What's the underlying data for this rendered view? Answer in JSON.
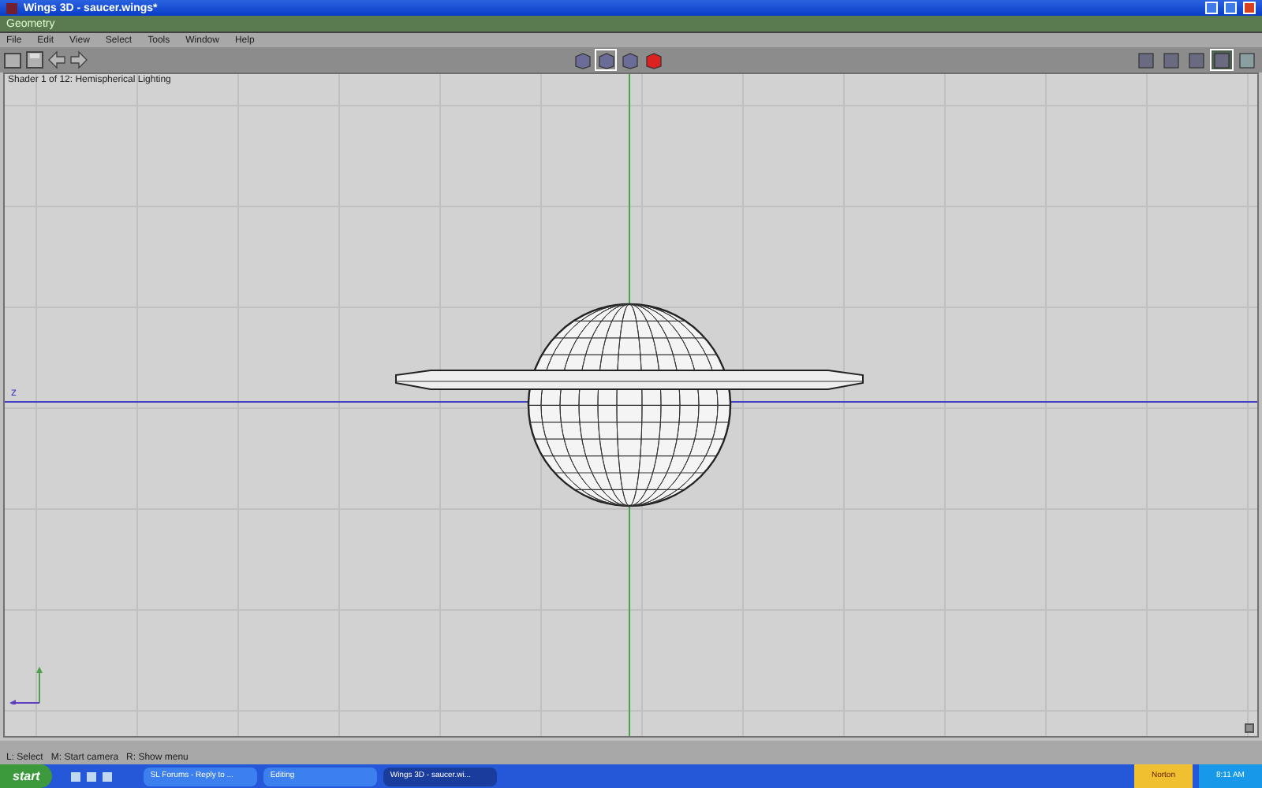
{
  "window": {
    "title": "Wings 3D - saucer.wings*"
  },
  "geometry_bar": {
    "title": "Geometry"
  },
  "menu": [
    "File",
    "Edit",
    "View",
    "Select",
    "Tools",
    "Window",
    "Help"
  ],
  "shader_modes": [
    {
      "selected": false
    },
    {
      "selected": true
    },
    {
      "selected": false
    },
    {
      "selected": false
    }
  ],
  "right_tools": [
    {
      "selected": false
    },
    {
      "selected": false
    },
    {
      "selected": false
    },
    {
      "selected": true
    },
    {
      "selected": false
    }
  ],
  "viewport": {
    "info": "Shader 1 of 12: Hemispherical Lighting",
    "axis_label": "z"
  },
  "status_bar": [
    "L: Select",
    "M: Start camera",
    "R: Show menu"
  ],
  "taskbar": {
    "start": "start",
    "tasks": [
      {
        "label": "SL Forums - Reply to ...",
        "selected": false
      },
      {
        "label": "Editing",
        "selected": false
      },
      {
        "label": "Wings 3D - saucer.wi...",
        "selected": true
      }
    ],
    "norton": "Norton",
    "time": "8:11 AM"
  }
}
